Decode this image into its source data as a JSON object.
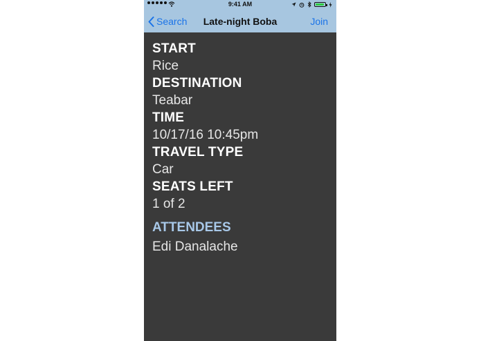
{
  "status_bar": {
    "time": "9:41 AM",
    "battery_level": 0.9,
    "icons": [
      "signal-dots-icon",
      "wifi-icon",
      "location-icon",
      "alarm-icon",
      "bluetooth-icon",
      "battery-icon",
      "charging-icon"
    ]
  },
  "navbar": {
    "back_label": "Search",
    "title": "Late-night Boba",
    "action_label": "Join",
    "background": "#a7c6e0",
    "tint": "#1a73e8"
  },
  "details": [
    {
      "label": "START",
      "value": "Rice"
    },
    {
      "label": "DESTINATION",
      "value": "Teabar"
    },
    {
      "label": "TIME",
      "value": "10/17/16 10:45pm"
    },
    {
      "label": "TRAVEL TYPE",
      "value": "Car"
    },
    {
      "label": "SEATS LEFT",
      "value": "1 of 2"
    }
  ],
  "attendees": {
    "label": "ATTENDEES",
    "names": [
      "Edi Danalache"
    ],
    "label_color": "#a8c8e8"
  },
  "colors": {
    "content_background": "#3a3a3a"
  }
}
